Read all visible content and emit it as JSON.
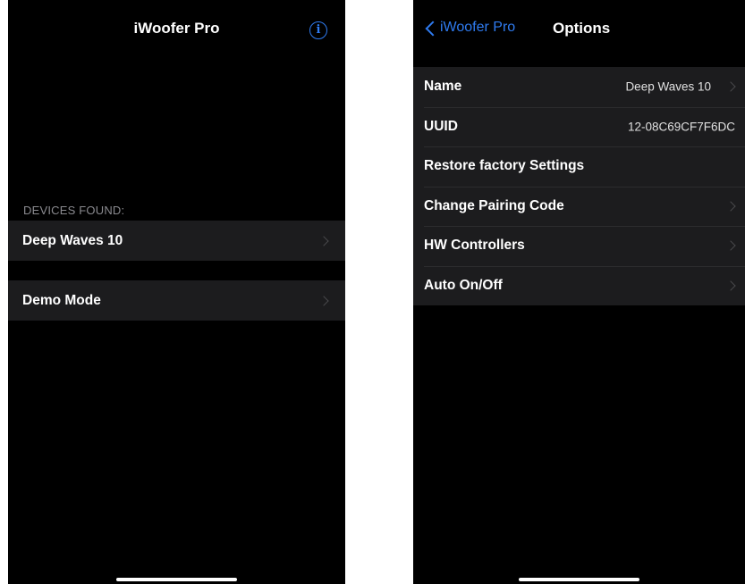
{
  "left_screen": {
    "title": "iWoofer Pro",
    "info_icon": "info-circle-icon",
    "info_glyph": "i",
    "section_header": "DEVICES FOUND:",
    "rows": [
      {
        "label": "Deep Waves 10"
      },
      {
        "label": "Demo Mode"
      }
    ]
  },
  "right_screen": {
    "back_label": "iWoofer Pro",
    "title": "Options",
    "rows": [
      {
        "label": "Name",
        "value": "Deep Waves 10"
      },
      {
        "label": "UUID",
        "value": "12-08C69CF7F6DC"
      },
      {
        "label": "Restore factory Settings"
      },
      {
        "label": "Change Pairing Code"
      },
      {
        "label": "HW Controllers"
      },
      {
        "label": "Auto On/Off"
      }
    ]
  },
  "colors": {
    "accent": "#2f7bf0",
    "background": "#000000",
    "cell": "#1c1c1e",
    "section_header": "#8a8a8f"
  }
}
